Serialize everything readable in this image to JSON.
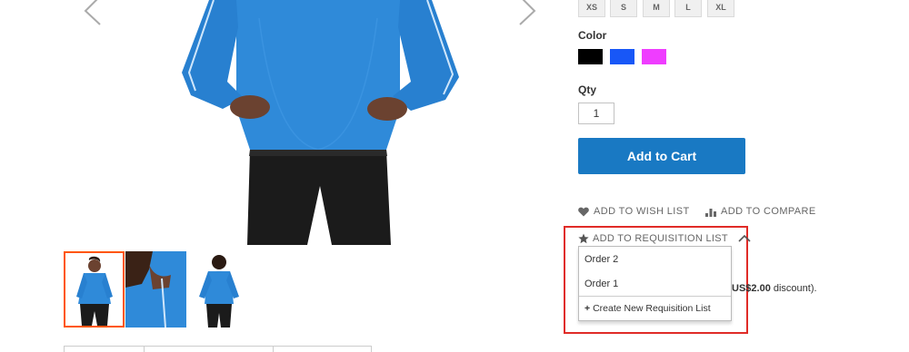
{
  "gallery": {
    "prev_icon": "chevron-left-icon",
    "next_icon": "chevron-right-icon",
    "thumbnails": [
      "front-view",
      "collar-detail",
      "back-view"
    ],
    "active_thumb": 0
  },
  "options": {
    "sizes": [
      "XS",
      "S",
      "M",
      "L",
      "XL"
    ],
    "color_label": "Color",
    "colors": [
      "#000000",
      "#1857f7",
      "#ef3dff"
    ],
    "qty_label": "Qty",
    "qty_value": "1"
  },
  "actions": {
    "add_to_cart": "Add to Cart",
    "wish_list": "ADD TO WISH LIST",
    "compare": "ADD TO COMPARE",
    "wish_icon": "heart-icon",
    "compare_icon": "bar-chart-icon"
  },
  "requisition": {
    "toggle_label": "ADD TO REQUISITION LIST",
    "toggle_icon": "star-icon",
    "expanded_icon": "chevron-up-icon",
    "items": [
      "Order 2",
      "Order 1"
    ],
    "create_plus": "+",
    "create_label": "Create New Requisition List"
  },
  "discount": {
    "amount": "US$2.00",
    "suffix": " discount)."
  },
  "colors": {
    "accent": "#1979c3",
    "highlight_border": "#e02b27",
    "active_thumb_border": "#ff5501",
    "shirt": "#2f8ad9"
  }
}
